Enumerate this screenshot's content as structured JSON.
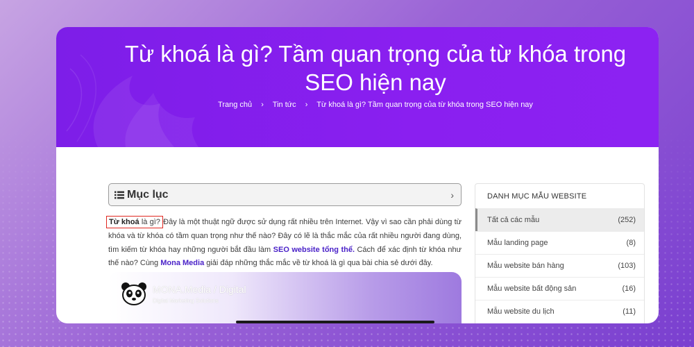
{
  "hero": {
    "title_line1": "Từ khoá là gì? Tầm quan trọng của từ khóa trong",
    "title_line2": "SEO hiện nay"
  },
  "breadcrumb": {
    "items": [
      "Trang chủ",
      "Tin tức",
      "Từ khoá là gì? Tầm quan trọng của từ khóa trong SEO hiện nay"
    ]
  },
  "toc": {
    "label": "Mục lục",
    "icon": "list-icon",
    "toggle_icon": "chevron-right-icon"
  },
  "article": {
    "keyword": "Từ khoá",
    "keyword_rest": " là gì?",
    "part1": " Đây là một thuật ngữ được sử dụng rất nhiều trên Internet. Vậy vì sao cần phải dùng từ khóa và từ khóa có tầm quan trọng như thế nào? Đây có lẽ là thắc mắc của rất nhiều người đang dùng, tìm kiếm từ khóa hay những người bắt đầu làm ",
    "link1": "SEO website tổng thể.",
    "part2": " Cách để xác định từ khóa như thế nào? Cùng ",
    "link2": "Mona Media",
    "part3": " giải đáp những thắc mắc về từ khoá là gì qua bài chia sẻ dưới đây."
  },
  "banner": {
    "brand": "MONA.Media / Digital",
    "tagline": "Digital Marketing Solutions",
    "logo_icon": "panda-icon"
  },
  "sidebar": {
    "title": "DANH MỤC MẪU WEBSITE",
    "items": [
      {
        "label": "Tất cả các mẫu",
        "count": "(252)"
      },
      {
        "label": "Mẫu landing page",
        "count": "(8)"
      },
      {
        "label": "Mẫu website bán hàng",
        "count": "(103)"
      },
      {
        "label": "Mẫu website bất động sản",
        "count": "(16)"
      },
      {
        "label": "Mẫu website du lịch",
        "count": "(11)"
      }
    ]
  },
  "colors": {
    "hero": "#8a1ff0",
    "link": "#4a22c8",
    "keyword_outline": "#e0261f"
  }
}
